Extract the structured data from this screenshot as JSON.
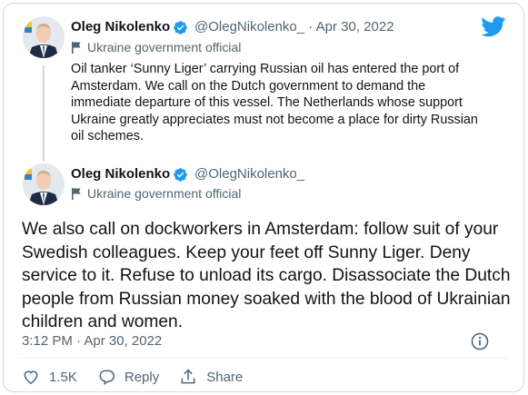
{
  "colors": {
    "brand_blue": "#1d9bf0",
    "text_primary": "#0f1419",
    "text_secondary": "#536471",
    "border": "#cfd9de"
  },
  "tweet1": {
    "author_name": "Oleg Nikolenko",
    "handle": "@OlegNikolenko_",
    "separator": "·",
    "date": "Apr 30, 2022",
    "label": "Ukraine government official",
    "text": "Oil tanker ‘Sunny Liger’ carrying Russian oil has entered the port of Amsterdam. We call on the Dutch government to demand the immediate departure of this vessel. The Netherlands whose support Ukraine greatly appreciates must not become a place for dirty Russian oil schemes."
  },
  "tweet2": {
    "author_name": "Oleg Nikolenko",
    "handle": "@OlegNikolenko_",
    "label": "Ukraine government official",
    "text": "We also call on dockworkers in Amsterdam: follow suit of your Swedish colleagues. Keep your feet off Sunny Liger. Deny service to it. Refuse to unload its cargo. Disassociate the Dutch people from Russian money soaked with the blood of Ukrainian children and women.",
    "timestamp": "3:12 PM · Apr 30, 2022"
  },
  "actions": {
    "like_count": "1.5K",
    "reply_label": "Reply",
    "share_label": "Share"
  },
  "icons": [
    "verified-badge-icon",
    "flag-icon",
    "twitter-bird-icon",
    "info-icon",
    "heart-icon",
    "reply-icon",
    "share-icon"
  ]
}
